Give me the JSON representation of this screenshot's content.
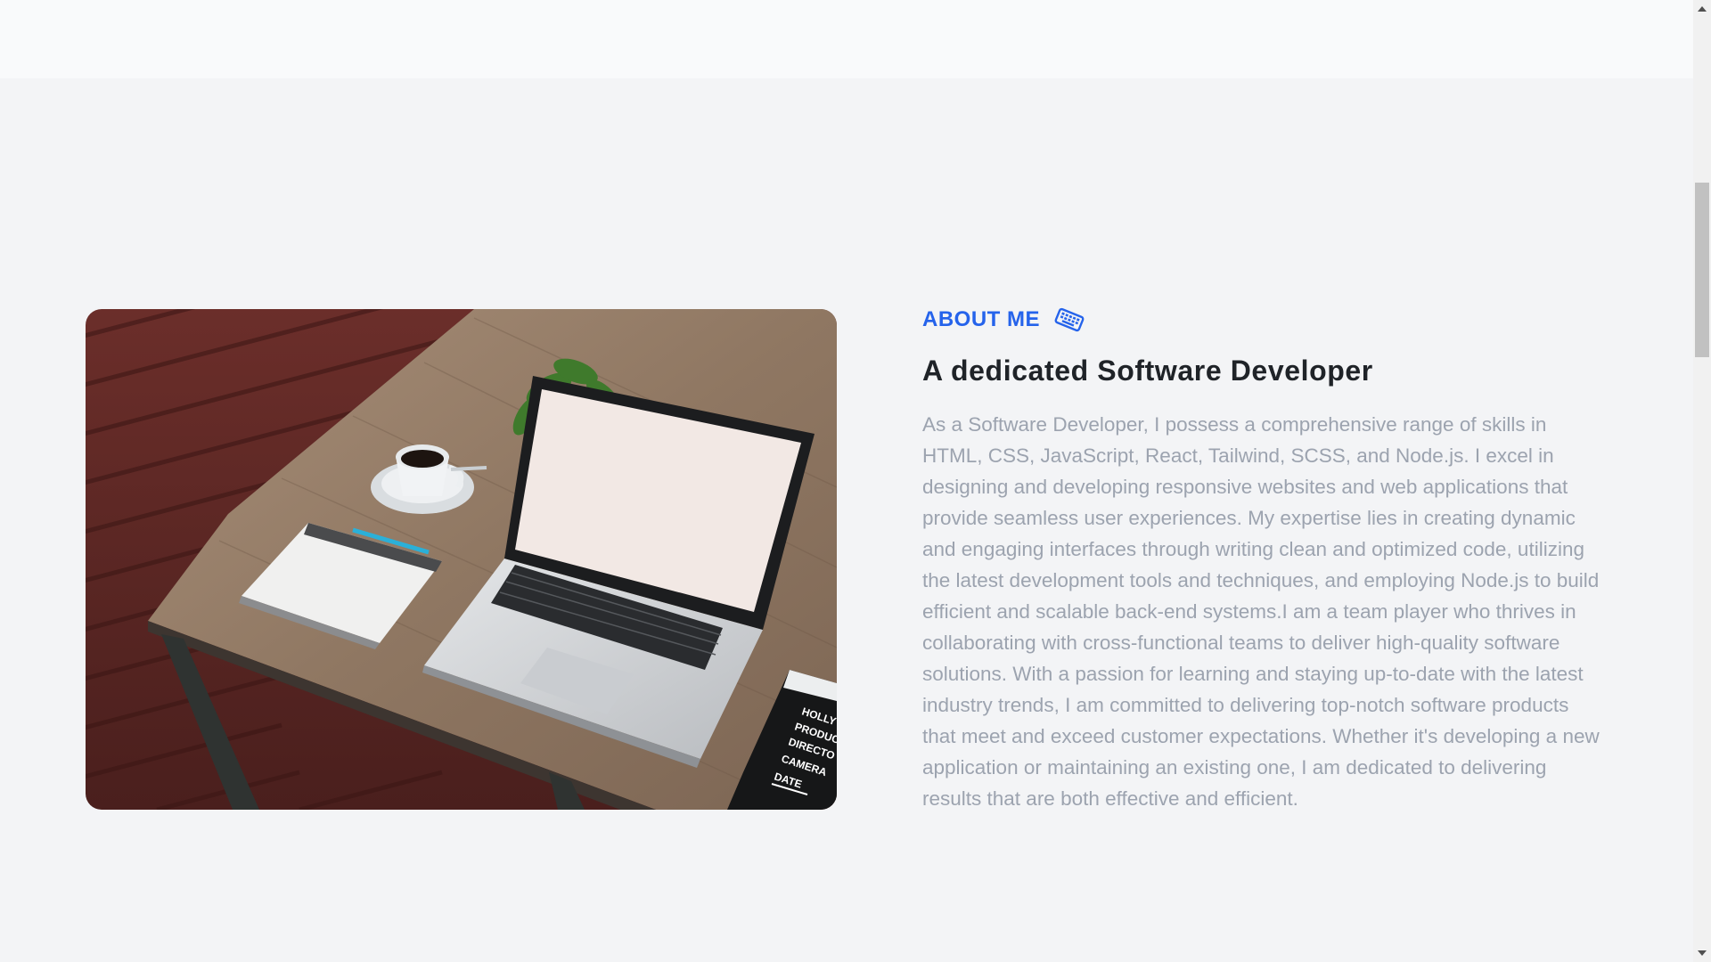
{
  "about": {
    "kicker": "ABOUT ME",
    "kicker_icon": "keyboard-icon",
    "title": "A dedicated Software Developer",
    "body": "As a Software Developer, I possess a comprehensive range of skills in HTML, CSS, JavaScript, React, Tailwind, SCSS, and Node.js. I excel in designing and developing responsive websites and web applications that provide seamless user experiences. My expertise lies in creating dynamic and engaging interfaces through writing clean and optimized code, utilizing the latest development tools and techniques, and employing Node.js to build efficient and scalable back-end systems.I am a team player who thrives in collaborating with cross-functional teams to deliver high-quality software solutions. With a passion for learning and staying up-to-date with the latest industry trends, I am committed to delivering top-notch software products that meet and exceed customer expectations. Whether it's developing a new application or maintaining an existing one, I am dedicated to delivering results that are both effective and efficient.",
    "image_icon": "laptop-on-desk-photo",
    "clapper_text": [
      "HOLLY",
      "PRODUC",
      "DIRECTO",
      "CAMERA",
      "DATE"
    ]
  },
  "colors": {
    "accent": "#2563eb",
    "heading": "#1f2328",
    "body_text": "#9ca3af",
    "background": "#f3f4f6"
  }
}
